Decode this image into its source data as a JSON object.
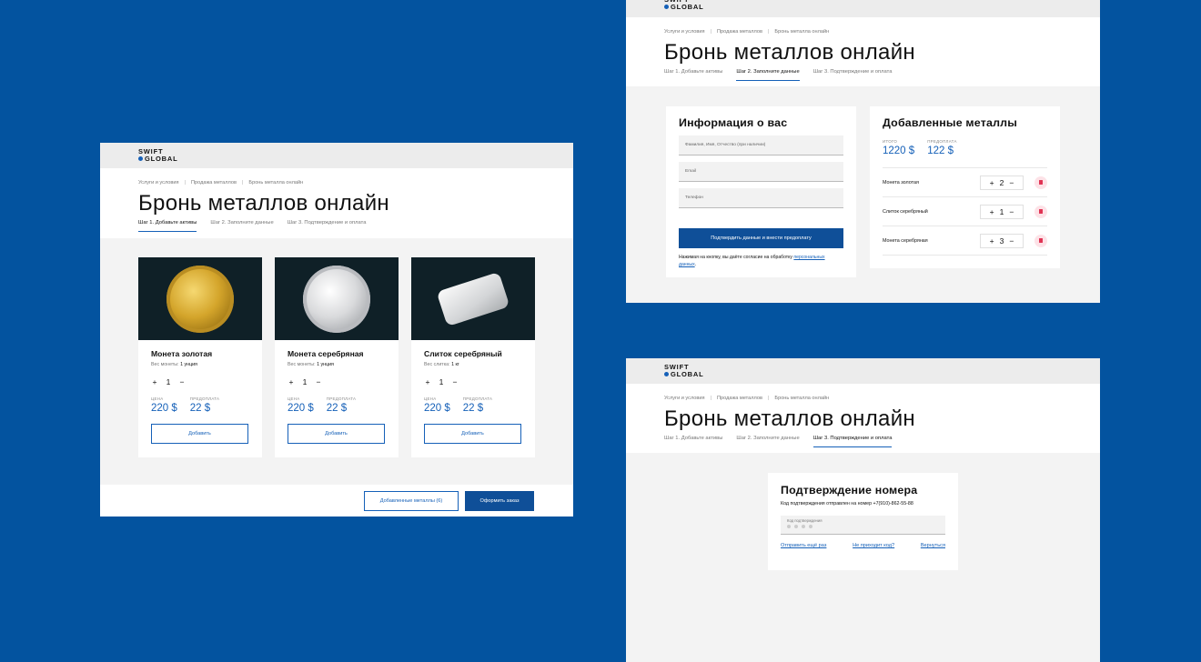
{
  "logo": {
    "line1": "SWIFT",
    "line2": "GLOBAL"
  },
  "breadcrumbs": [
    "Услуги и условия",
    "Продажа металлов",
    "Бронь металла онлайн"
  ],
  "breadcrumb_sep": "|",
  "page_title": "Бронь металлов онлайн",
  "steps": [
    "Шаг 1. Добавьте активы",
    "Шаг 2. Заполните данные",
    "Шаг 3. Подтверждение и оплата"
  ],
  "catalog": {
    "products": [
      {
        "name": "Монета золотая",
        "weight_label": "Вес монеты:",
        "weight": "1 унция",
        "qty": "1",
        "price_label": "ЦЕНА",
        "price": "220 $",
        "prepay_label": "ПРЕДОПЛАТА",
        "prepay": "22 $",
        "add_label": "Добавить",
        "image": "gold-coin"
      },
      {
        "name": "Монета серебряная",
        "weight_label": "Вес монеты:",
        "weight": "1 унция",
        "qty": "1",
        "price_label": "ЦЕНА",
        "price": "220 $",
        "prepay_label": "ПРЕДОПЛАТА",
        "prepay": "22 $",
        "add_label": "Добавить",
        "image": "silver-coin"
      },
      {
        "name": "Слиток серебряный",
        "weight_label": "Вес слитка:",
        "weight": "1 кг",
        "qty": "1",
        "price_label": "ЦЕНА",
        "price": "220 $",
        "prepay_label": "ПРЕДОПЛАТА",
        "prepay": "22 $",
        "add_label": "Добавить",
        "image": "silver-bar"
      }
    ],
    "footer": {
      "added_label": "Добавленные металлы (6)",
      "order_label": "Оформить заказ"
    }
  },
  "plus": "+",
  "minus": "−",
  "info_form": {
    "title": "Информация о вас",
    "name_placeholder": "Фамилия, Имя, Отчество (при наличии)",
    "email_placeholder": "Email",
    "phone_placeholder": "Телефон",
    "submit_label": "Подтвердить данные и внести предоплату",
    "consent_text": "Нажимая на кнопку, вы даёте согласие на обработку",
    "consent_link": "персональных данных",
    "consent_end": "."
  },
  "added_metals": {
    "title": "Добавленные металлы",
    "total_label": "ИТОГО",
    "total": "1220 $",
    "prepay_label": "ПРЕДОПЛАТА",
    "prepay": "122 $",
    "items": [
      {
        "name": "Монета золотая",
        "qty": "2"
      },
      {
        "name": "Слиток серебряный",
        "qty": "1"
      },
      {
        "name": "Монета серебряная",
        "qty": "3"
      }
    ]
  },
  "verification": {
    "title": "Подтверждение номера",
    "subtitle": "Код подтверждения отправлен на номер +7(910)-862-55-88",
    "code_label": "Код подтверждения",
    "resend_label": "Отправить ещё раз",
    "no_code_label": "Не приходит код?",
    "back_label": "Вернуться"
  },
  "colors": {
    "background": "#03539f",
    "accent": "#1560b8",
    "primary_button": "#0f4f98",
    "delete": "#e03454"
  }
}
